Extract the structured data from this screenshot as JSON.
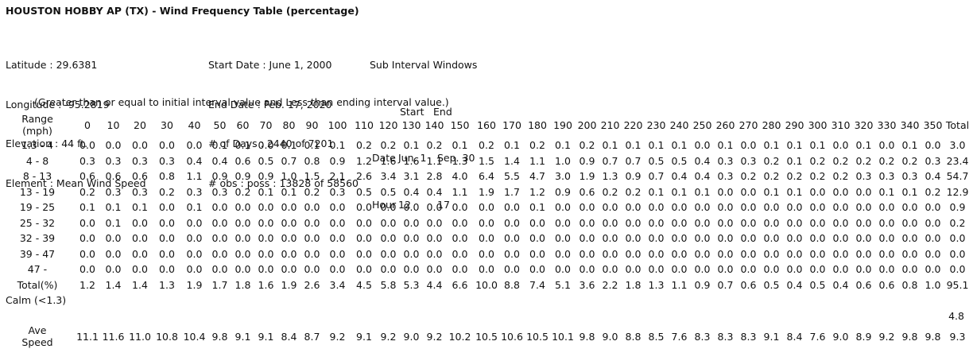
{
  "title": "HOUSTON HOBBY AP (TX) - Wind Frequency Table (percentage)",
  "station": {
    "latitude": "Latitude : 29.6381",
    "longitude": "Longitude : -95.2819",
    "elevation": "Elevation : 44 ft.",
    "element": "Element : Mean Wind Speed"
  },
  "period": {
    "start": "Start Date : June 1, 2000",
    "end": "End Date : Feb. 17, 2020",
    "days": "# of Days : 2440 of 7201",
    "obs": "# obs : poss : 13828 of 58560"
  },
  "subinterval": {
    "heading": "Sub Interval Windows",
    "start_label": "Start",
    "end_label": "End",
    "date_label": "Date",
    "date_start": "Jun. 1",
    "date_end": "Sep. 30",
    "hour_label": "Hour",
    "hour_start": "12",
    "hour_end": "17"
  },
  "note": "(Greater than or equal to initial interval value and Less than ending interval value.)",
  "table": {
    "range_header": "Range",
    "range_unit": "(mph)",
    "total_header": "Total",
    "directions": [
      "0",
      "10",
      "20",
      "30",
      "40",
      "50",
      "60",
      "70",
      "80",
      "90",
      "100",
      "110",
      "120",
      "130",
      "140",
      "150",
      "160",
      "170",
      "180",
      "190",
      "200",
      "210",
      "220",
      "230",
      "240",
      "250",
      "260",
      "270",
      "280",
      "290",
      "300",
      "310",
      "320",
      "330",
      "340",
      "350"
    ],
    "rows": [
      {
        "range": "1.3 - 4",
        "values": [
          "0.0",
          "0.0",
          "0.0",
          "0.0",
          "0.0",
          "0.1",
          "0.1",
          "0.0",
          "0.1",
          "0.1",
          "0.1",
          "0.2",
          "0.2",
          "0.1",
          "0.2",
          "0.1",
          "0.2",
          "0.1",
          "0.2",
          "0.1",
          "0.2",
          "0.1",
          "0.1",
          "0.1",
          "0.1",
          "0.0",
          "0.1",
          "0.0",
          "0.1",
          "0.1",
          "0.1",
          "0.0",
          "0.1",
          "0.0",
          "0.1",
          "0.0"
        ],
        "total": "3.0"
      },
      {
        "range": "4 - 8",
        "values": [
          "0.3",
          "0.3",
          "0.3",
          "0.3",
          "0.4",
          "0.4",
          "0.6",
          "0.5",
          "0.7",
          "0.8",
          "0.9",
          "1.2",
          "1.6",
          "1.6",
          "1.1",
          "1.3",
          "1.5",
          "1.4",
          "1.1",
          "1.0",
          "0.9",
          "0.7",
          "0.7",
          "0.5",
          "0.5",
          "0.4",
          "0.3",
          "0.3",
          "0.2",
          "0.1",
          "0.2",
          "0.2",
          "0.2",
          "0.2",
          "0.2",
          "0.3"
        ],
        "total": "23.4"
      },
      {
        "range": "8 - 13",
        "values": [
          "0.6",
          "0.6",
          "0.6",
          "0.8",
          "1.1",
          "0.9",
          "0.9",
          "0.9",
          "1.0",
          "1.5",
          "2.1",
          "2.6",
          "3.4",
          "3.1",
          "2.8",
          "4.0",
          "6.4",
          "5.5",
          "4.7",
          "3.0",
          "1.9",
          "1.3",
          "0.9",
          "0.7",
          "0.4",
          "0.4",
          "0.3",
          "0.2",
          "0.2",
          "0.2",
          "0.2",
          "0.2",
          "0.3",
          "0.3",
          "0.3",
          "0.4"
        ],
        "total": "54.7"
      },
      {
        "range": "13 - 19",
        "values": [
          "0.2",
          "0.3",
          "0.3",
          "0.2",
          "0.3",
          "0.3",
          "0.2",
          "0.1",
          "0.1",
          "0.2",
          "0.3",
          "0.5",
          "0.5",
          "0.4",
          "0.4",
          "1.1",
          "1.9",
          "1.7",
          "1.2",
          "0.9",
          "0.6",
          "0.2",
          "0.2",
          "0.1",
          "0.1",
          "0.1",
          "0.0",
          "0.0",
          "0.1",
          "0.1",
          "0.0",
          "0.0",
          "0.0",
          "0.1",
          "0.1",
          "0.2"
        ],
        "total": "12.9"
      },
      {
        "range": "19 - 25",
        "values": [
          "0.1",
          "0.1",
          "0.1",
          "0.0",
          "0.1",
          "0.0",
          "0.0",
          "0.0",
          "0.0",
          "0.0",
          "0.0",
          "0.0",
          "0.0",
          "0.0",
          "0.0",
          "0.0",
          "0.0",
          "0.0",
          "0.1",
          "0.0",
          "0.0",
          "0.0",
          "0.0",
          "0.0",
          "0.0",
          "0.0",
          "0.0",
          "0.0",
          "0.0",
          "0.0",
          "0.0",
          "0.0",
          "0.0",
          "0.0",
          "0.0",
          "0.0"
        ],
        "total": "0.9"
      },
      {
        "range": "25 - 32",
        "values": [
          "0.0",
          "0.1",
          "0.0",
          "0.0",
          "0.0",
          "0.0",
          "0.0",
          "0.0",
          "0.0",
          "0.0",
          "0.0",
          "0.0",
          "0.0",
          "0.0",
          "0.0",
          "0.0",
          "0.0",
          "0.0",
          "0.0",
          "0.0",
          "0.0",
          "0.0",
          "0.0",
          "0.0",
          "0.0",
          "0.0",
          "0.0",
          "0.0",
          "0.0",
          "0.0",
          "0.0",
          "0.0",
          "0.0",
          "0.0",
          "0.0",
          "0.0"
        ],
        "total": "0.2"
      },
      {
        "range": "32 - 39",
        "values": [
          "0.0",
          "0.0",
          "0.0",
          "0.0",
          "0.0",
          "0.0",
          "0.0",
          "0.0",
          "0.0",
          "0.0",
          "0.0",
          "0.0",
          "0.0",
          "0.0",
          "0.0",
          "0.0",
          "0.0",
          "0.0",
          "0.0",
          "0.0",
          "0.0",
          "0.0",
          "0.0",
          "0.0",
          "0.0",
          "0.0",
          "0.0",
          "0.0",
          "0.0",
          "0.0",
          "0.0",
          "0.0",
          "0.0",
          "0.0",
          "0.0",
          "0.0"
        ],
        "total": "0.0"
      },
      {
        "range": "39 - 47",
        "values": [
          "0.0",
          "0.0",
          "0.0",
          "0.0",
          "0.0",
          "0.0",
          "0.0",
          "0.0",
          "0.0",
          "0.0",
          "0.0",
          "0.0",
          "0.0",
          "0.0",
          "0.0",
          "0.0",
          "0.0",
          "0.0",
          "0.0",
          "0.0",
          "0.0",
          "0.0",
          "0.0",
          "0.0",
          "0.0",
          "0.0",
          "0.0",
          "0.0",
          "0.0",
          "0.0",
          "0.0",
          "0.0",
          "0.0",
          "0.0",
          "0.0",
          "0.0"
        ],
        "total": "0.0"
      },
      {
        "range": "47 -",
        "values": [
          "0.0",
          "0.0",
          "0.0",
          "0.0",
          "0.0",
          "0.0",
          "0.0",
          "0.0",
          "0.0",
          "0.0",
          "0.0",
          "0.0",
          "0.0",
          "0.0",
          "0.0",
          "0.0",
          "0.0",
          "0.0",
          "0.0",
          "0.0",
          "0.0",
          "0.0",
          "0.0",
          "0.0",
          "0.0",
          "0.0",
          "0.0",
          "0.0",
          "0.0",
          "0.0",
          "0.0",
          "0.0",
          "0.0",
          "0.0",
          "0.0",
          "0.0"
        ],
        "total": "0.0"
      }
    ],
    "total_row": {
      "label": "Total(%)",
      "values": [
        "1.2",
        "1.4",
        "1.4",
        "1.3",
        "1.9",
        "1.7",
        "1.8",
        "1.6",
        "1.9",
        "2.6",
        "3.4",
        "4.5",
        "5.8",
        "5.3",
        "4.4",
        "6.6",
        "10.0",
        "8.8",
        "7.4",
        "5.1",
        "3.6",
        "2.2",
        "1.8",
        "1.3",
        "1.1",
        "0.9",
        "0.7",
        "0.6",
        "0.5",
        "0.4",
        "0.5",
        "0.4",
        "0.6",
        "0.6",
        "0.8",
        "1.0"
      ],
      "total": "95.1"
    },
    "calm": {
      "label": "Calm (<1.3)",
      "value": "4.8"
    },
    "speed_row": {
      "label_line1": "Ave",
      "label_line2": "Speed",
      "values": [
        "11.1",
        "11.6",
        "11.0",
        "10.8",
        "10.4",
        "9.8",
        "9.1",
        "9.1",
        "8.4",
        "8.7",
        "9.2",
        "9.1",
        "9.2",
        "9.0",
        "9.2",
        "10.2",
        "10.5",
        "10.6",
        "10.5",
        "10.1",
        "9.8",
        "9.0",
        "8.8",
        "8.5",
        "7.6",
        "8.3",
        "8.3",
        "8.3",
        "9.1",
        "8.4",
        "7.6",
        "9.0",
        "8.9",
        "9.2",
        "9.8",
        "9.8"
      ],
      "total": "9.3"
    }
  }
}
